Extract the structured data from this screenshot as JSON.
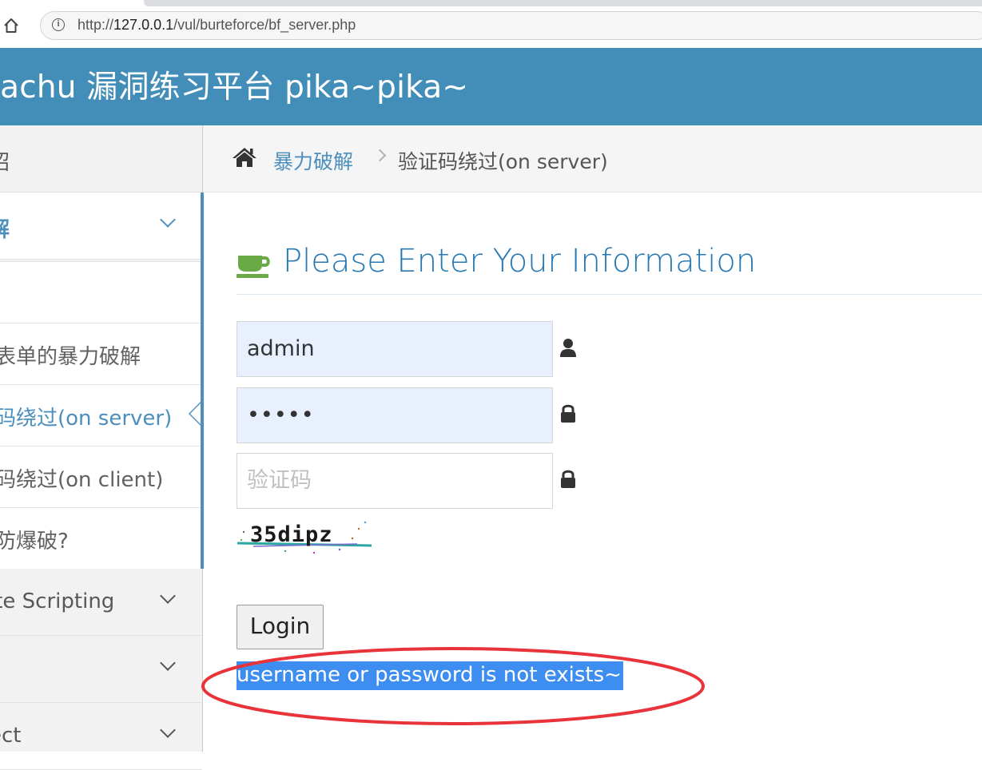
{
  "browser": {
    "url_prefix": "http://",
    "url_host": "127.0.0.1",
    "url_path": "/vul/burteforce/bf_server.php"
  },
  "header": {
    "brand": "kachu 漏洞练习平台 pika~pika~"
  },
  "sidebar": {
    "items": [
      {
        "label": "绍",
        "expanded": false
      },
      {
        "label": "解",
        "expanded": true
      },
      {
        "label": "ite Scripting",
        "expanded": false
      },
      {
        "label": "",
        "expanded": false
      },
      {
        "label": "ect",
        "expanded": false
      }
    ],
    "submenu": [
      {
        "label": "",
        "active": false
      },
      {
        "label": "表单的暴力破解",
        "active": false
      },
      {
        "label": "码绕过(on server)",
        "active": true
      },
      {
        "label": "码绕过(on client)",
        "active": false
      },
      {
        "label": "防爆破?",
        "active": false
      }
    ]
  },
  "breadcrumb": {
    "parent": "暴力破解",
    "current": "验证码绕过(on server)"
  },
  "form": {
    "title": "Please Enter Your Information",
    "username_value": "admin",
    "password_value": "•••••",
    "captcha_placeholder": "验证码",
    "captcha_image_text": "35dipz",
    "login_label": "Login",
    "result_message": "username or password is not exists~"
  },
  "colors": {
    "header_blue": "#438eb9",
    "link_blue": "#4c8fbd",
    "title_blue": "#2679b5",
    "selection_blue": "#3d8ef0",
    "annotation_red": "#e8333a",
    "coffee_green": "#69aa46"
  },
  "icons": {
    "home": "home-icon",
    "info": "info-icon",
    "breadcrumb_home": "home-icon",
    "title": "coffee-icon",
    "username": "user-icon",
    "password": "lock-icon",
    "captcha": "lock-icon",
    "menu_toggle": "chevron-down-icon",
    "active_marker": "caret-left-icon"
  }
}
